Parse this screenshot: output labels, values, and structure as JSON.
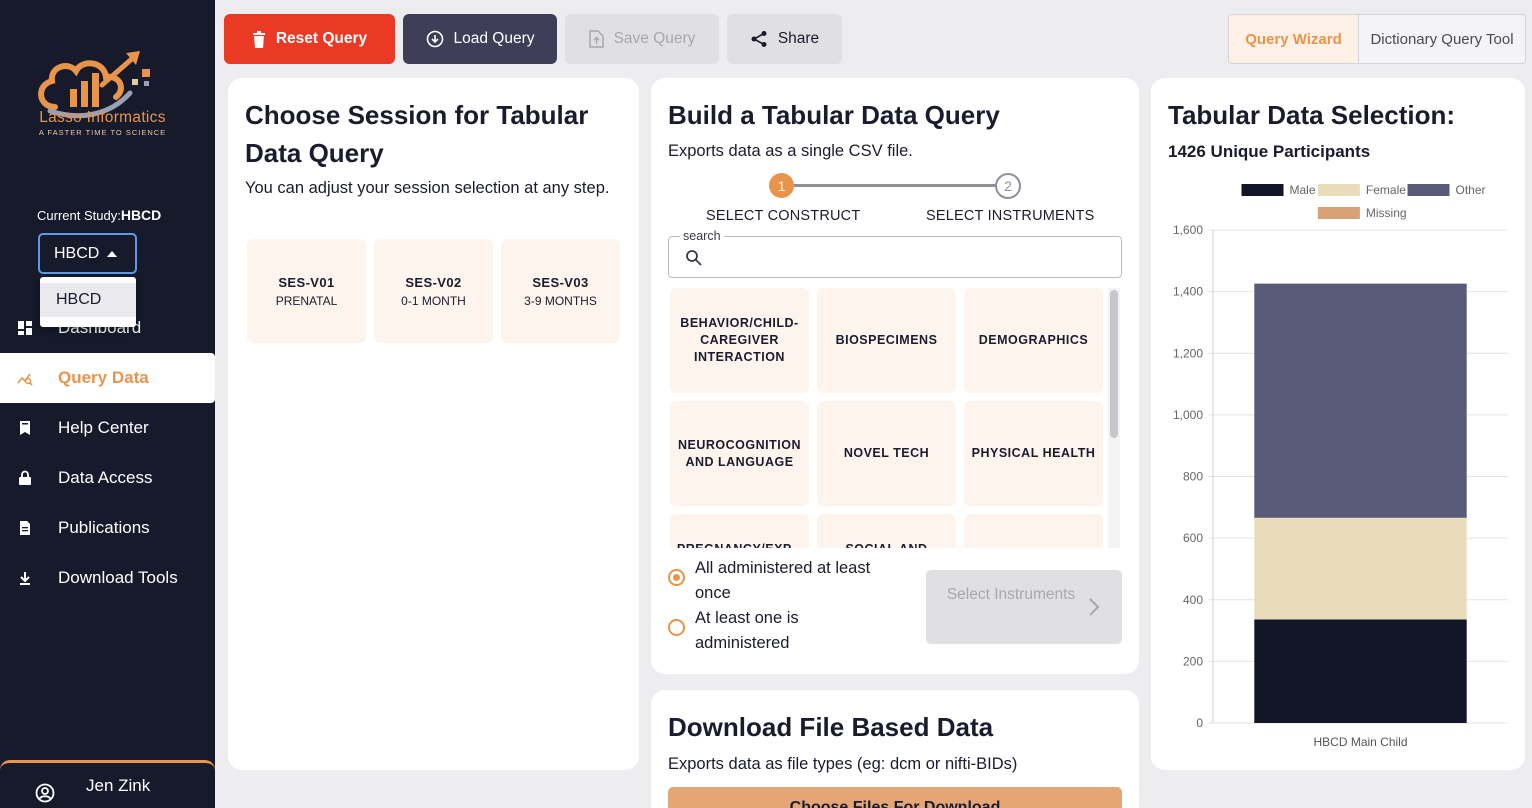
{
  "brand": {
    "name": "Lasso Informatics",
    "tagline": "A FASTER TIME TO SCIENCE",
    "colors": {
      "orange": "#e8944a",
      "navy": "#161a2b",
      "red": "#ea3a25"
    }
  },
  "study": {
    "label": "Current Study:",
    "value": "HBCD",
    "selected": "HBCD",
    "options": [
      "HBCD"
    ]
  },
  "nav": {
    "items": [
      {
        "label": "Dashboard",
        "icon": "dashboard-icon"
      },
      {
        "label": "Query Data",
        "icon": "query-icon",
        "active": true
      },
      {
        "label": "Help Center",
        "icon": "book-icon"
      },
      {
        "label": "Data Access",
        "icon": "lock-icon"
      },
      {
        "label": "Publications",
        "icon": "document-icon"
      },
      {
        "label": "Download Tools",
        "icon": "download-icon"
      }
    ]
  },
  "user": {
    "name": "Jen Zink",
    "icon": "account-circle-icon"
  },
  "toolbar": {
    "reset": "Reset Query",
    "load": "Load Query",
    "save": "Save Query",
    "share": "Share",
    "mode_active": "Query Wizard",
    "mode_other": "Dictionary Query Tool"
  },
  "session_card": {
    "title": "Choose Session for Tabular Data Query",
    "subtitle": "You can adjust your session selection at any step.",
    "sessions": [
      {
        "code": "SES-V01",
        "time": "PRENATAL"
      },
      {
        "code": "SES-V02",
        "time": "0-1 MONTH"
      },
      {
        "code": "SES-V03",
        "time": "3-9 MONTHS"
      }
    ]
  },
  "build_card": {
    "title": "Build a Tabular Data Query",
    "subtitle": "Exports data as a single CSV file.",
    "steps": [
      {
        "number": "1",
        "label": "SELECT CONSTRUCT"
      },
      {
        "number": "2",
        "label": "SELECT INSTRUMENTS"
      }
    ],
    "search": {
      "legend": "search",
      "value": ""
    },
    "constructs": [
      "BEHAVIOR/CHILD-CAREGIVER INTERACTION",
      "BIOSPECIMENS",
      "DEMOGRAPHICS",
      "NEUROCOGNITION AND LANGUAGE",
      "NOVEL TECH",
      "PHYSICAL HEALTH",
      "PREGNANCY/EXP...",
      "SOCIAL AND",
      ""
    ],
    "options": [
      "All administered at least once",
      "At least one is administered"
    ],
    "select_button": "Select Instruments"
  },
  "download_card": {
    "title": "Download File Based Data",
    "subtitle": "Exports data as file types (eg: dcm or nifti-BIDs)",
    "button": "Choose Files For Download"
  },
  "selection_card": {
    "title": "Tabular Data Selection:",
    "participants": "1426 Unique Participants"
  },
  "chart_data": {
    "type": "bar",
    "stacked": true,
    "categories": [
      "HBCD Main Child"
    ],
    "series": [
      {
        "name": "Male",
        "values": [
          336
        ],
        "color": "#121627"
      },
      {
        "name": "Female",
        "values": [
          330
        ],
        "color": "#e9dcbb"
      },
      {
        "name": "Other",
        "values": [
          760
        ],
        "color": "#595c78"
      },
      {
        "name": "Missing",
        "values": [
          0
        ],
        "color": "#d9a176"
      }
    ],
    "ylim": [
      0,
      1600
    ],
    "yticks": [
      0,
      200,
      400,
      600,
      800,
      1000,
      1200,
      1400,
      1600
    ],
    "ytick_labels": [
      "0",
      "200",
      "400",
      "600",
      "800",
      "1,000",
      "1,200",
      "1,400",
      "1,600"
    ],
    "grid": true,
    "legend": "top"
  }
}
